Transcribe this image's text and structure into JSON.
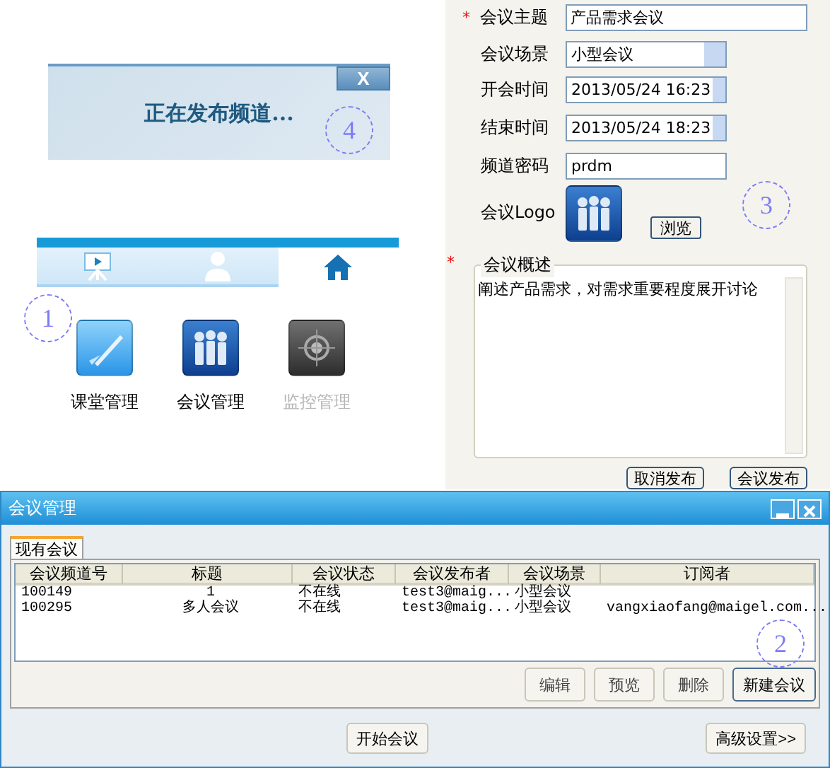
{
  "publish_dialog": {
    "close": "X",
    "message": "正在发布频道...",
    "callout": "4"
  },
  "nav": {
    "tabs": [
      {
        "kind": "board",
        "selected": false
      },
      {
        "kind": "person",
        "selected": false
      },
      {
        "kind": "home",
        "selected": true
      }
    ],
    "callout": "1",
    "apps": [
      {
        "kind": "classroom",
        "label": "课堂管理",
        "disabled": false
      },
      {
        "kind": "meeting",
        "label": "会议管理",
        "disabled": false
      },
      {
        "kind": "monitor",
        "label": "监控管理",
        "disabled": true
      }
    ]
  },
  "meeting_form": {
    "fields": [
      {
        "kind": "text",
        "label": "会议主题",
        "required": true,
        "value": "产品需求会议"
      },
      {
        "kind": "select",
        "label": "会议场景",
        "required": false,
        "value": "小型会议"
      },
      {
        "kind": "spin",
        "label": "开会时间",
        "required": false,
        "value": "2013/05/24  16:23"
      },
      {
        "kind": "spin",
        "label": "结束时间",
        "required": false,
        "value": "2013/05/24  18:23"
      },
      {
        "kind": "short",
        "label": "频道密码",
        "required": false,
        "value": "prdm"
      }
    ],
    "required_mark": "*",
    "logo_label": "会议Logo",
    "browse": "浏览",
    "callout": "3",
    "summary": {
      "label": "会议概述",
      "required": true,
      "value": "阐述产品需求，对需求重要程度展开讨论"
    },
    "buttons": [
      "取消发布",
      "会议发布"
    ]
  },
  "meeting_window": {
    "title": "会议管理",
    "tabs": [
      {
        "label": "现有会议",
        "selected": true
      }
    ],
    "table": {
      "columns": [
        "会议频道号",
        "标题",
        "会议状态",
        "会议发布者",
        "会议场景",
        "订阅者"
      ],
      "rows": [
        [
          "100149",
          "1",
          "不在线",
          "test3@maig...",
          "小型会议",
          ""
        ],
        [
          "100295",
          "多人会议",
          "不在线",
          "test3@maig...",
          "小型会议",
          "vangxiaofang@maigel.com..."
        ]
      ]
    },
    "callout": "2",
    "actions": [
      {
        "label": "编辑",
        "primary": false
      },
      {
        "label": "预览",
        "primary": false
      },
      {
        "label": "删除",
        "primary": false
      },
      {
        "label": "新建会议",
        "primary": true
      }
    ],
    "start": "开始会议",
    "advanced": "高级设置>>"
  }
}
